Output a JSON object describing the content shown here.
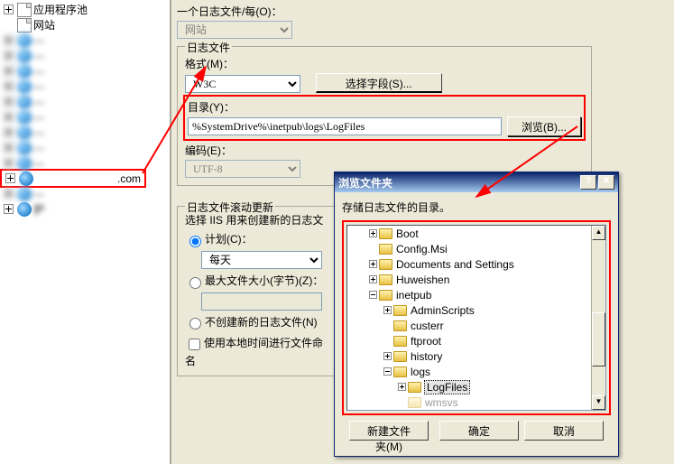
{
  "left_tree": {
    "apppool": "应用程序池",
    "websites": "网站",
    "site_suffix": ".com",
    "last": "护"
  },
  "top": {
    "per_label": "一个日志文件/每(O)：",
    "per_select": "网站"
  },
  "logfile": {
    "legend": "日志文件",
    "format_label": "格式(M)：",
    "format_value": "W3C",
    "select_fields_btn": "选择字段(S)...",
    "dir_label": "目录(Y)：",
    "dir_value": "%SystemDrive%\\inetpub\\logs\\LogFiles",
    "browse_btn": "浏览(B)...",
    "encoding_label": "编码(E)：",
    "encoding_value": "UTF-8"
  },
  "roll": {
    "legend": "日志文件滚动更新",
    "desc": "选择 IIS 用来创建新的日志文",
    "schedule_label": "计划(C)：",
    "schedule_value": "每天",
    "maxsize_label": "最大文件大小(字节)(Z)：",
    "nocreate_label": "不创建新的日志文件(N)",
    "localtime_label": "使用本地时间进行文件命名"
  },
  "dialog": {
    "title": "浏览文件夹",
    "instruction": "存储日志文件的目录。",
    "tree": [
      {
        "indent": 24,
        "exp": "plus",
        "label": "Boot"
      },
      {
        "indent": 24,
        "exp": "none",
        "label": "Config.Msi"
      },
      {
        "indent": 24,
        "exp": "plus",
        "label": "Documents and Settings"
      },
      {
        "indent": 24,
        "exp": "plus",
        "label": "Huweishen"
      },
      {
        "indent": 24,
        "exp": "minus",
        "label": "inetpub"
      },
      {
        "indent": 40,
        "exp": "plus",
        "label": "AdminScripts"
      },
      {
        "indent": 40,
        "exp": "none",
        "label": "custerr"
      },
      {
        "indent": 40,
        "exp": "none",
        "label": "ftproot"
      },
      {
        "indent": 40,
        "exp": "plus",
        "label": "history"
      },
      {
        "indent": 40,
        "exp": "minus",
        "label": "logs"
      },
      {
        "indent": 56,
        "exp": "plus",
        "label": "LogFiles",
        "selected": true
      },
      {
        "indent": 56,
        "exp": "none",
        "label": "wmsvs",
        "cut": true
      }
    ],
    "newfolder_btn": "新建文件夹(M)",
    "ok_btn": "确定",
    "cancel_btn": "取消"
  }
}
